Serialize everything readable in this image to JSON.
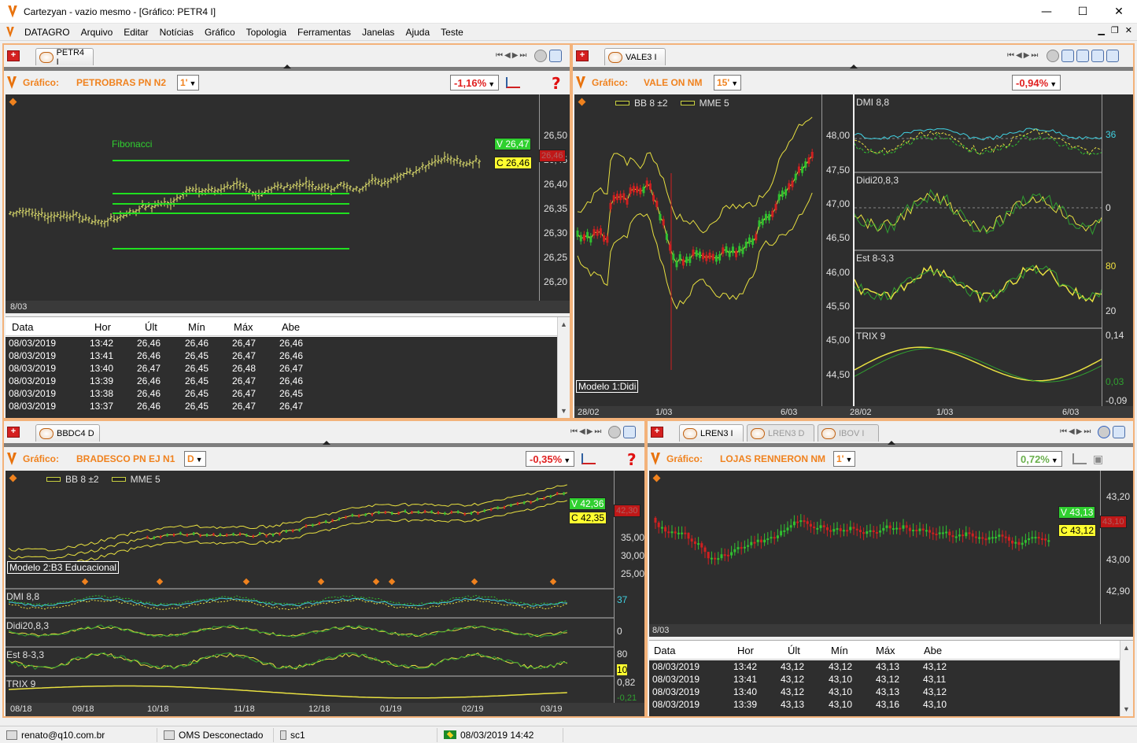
{
  "window": {
    "title": "Cartezyan - vazio mesmo - [Gráfico: PETR4 I]",
    "controls": [
      "—",
      "☐",
      "✕"
    ]
  },
  "menu": [
    "DATAGRO",
    "Arquivo",
    "Editar",
    "Notícias",
    "Gráfico",
    "Topologia",
    "Ferramentas",
    "Janelas",
    "Ajuda",
    "Teste"
  ],
  "panels": {
    "petr4": {
      "tab": "PETR4 I",
      "label": "Gráfico:",
      "name": "PETROBRAS PN N2",
      "period": "1'",
      "change": "-1,16%",
      "annotation": "Fibonacci",
      "y_ticks": [
        "26,50",
        "26,45",
        "26,40",
        "26,35",
        "26,30",
        "26,25",
        "26,20"
      ],
      "badge_v": "V 26,47",
      "badge_c": "C 26,46",
      "badge_last": "26,46",
      "x_label": "8/03",
      "table": {
        "headers": [
          "Data",
          "Hor",
          "Últ",
          "Mín",
          "Máx",
          "Abe"
        ],
        "rows": [
          [
            "08/03/2019",
            "13:42",
            "26,46",
            "26,46",
            "26,47",
            "26,46"
          ],
          [
            "08/03/2019",
            "13:41",
            "26,46",
            "26,45",
            "26,47",
            "26,46"
          ],
          [
            "08/03/2019",
            "13:40",
            "26,47",
            "26,45",
            "26,48",
            "26,47"
          ],
          [
            "08/03/2019",
            "13:39",
            "26,46",
            "26,45",
            "26,47",
            "26,46"
          ],
          [
            "08/03/2019",
            "13:38",
            "26,46",
            "26,45",
            "26,47",
            "26,45"
          ],
          [
            "08/03/2019",
            "13:37",
            "26,46",
            "26,45",
            "26,47",
            "26,47"
          ]
        ]
      }
    },
    "vale3": {
      "tab": "VALE3 I",
      "label": "Gráfico:",
      "name": "VALE ON NM",
      "period": "15'",
      "change": "-0,94%",
      "legend": [
        "BB 8 ±2",
        "MME 5"
      ],
      "model": "Modelo 1:Didi",
      "y_ticks": [
        "48,00",
        "47,50",
        "47,00",
        "46,50",
        "46,00",
        "45,50",
        "45,00",
        "44,50"
      ],
      "x_ticks": [
        "28/02",
        "1/03",
        "6/03"
      ],
      "indicators": [
        {
          "name": "DMI 8,8",
          "right": "36"
        },
        {
          "name": "Didi20,8,3",
          "right": "0"
        },
        {
          "name": "Est  8-3,3",
          "right": "80",
          "right2": "20"
        },
        {
          "name": "TRIX 9",
          "right": "0,14",
          "right2": "0,03",
          "right3": "-0,09"
        }
      ],
      "ind_x_ticks": [
        "28/02",
        "1/03",
        "6/03"
      ]
    },
    "bbdc4": {
      "tab": "BBDC4 D",
      "label": "Gráfico:",
      "name": "BRADESCO PN EJ N1",
      "period": "D",
      "change": "-0,35%",
      "legend": [
        "BB 8 ±2",
        "MME 5"
      ],
      "model": "Modelo 2:B3 Educacional",
      "y_ticks": [
        "35,00",
        "30,00",
        "25,00"
      ],
      "badge_v": "V 42,36",
      "badge_c": "C 42,35",
      "badge_last": "42,30",
      "indicators": [
        {
          "name": "DMI 8,8",
          "right": "37"
        },
        {
          "name": "Didi20,8,3",
          "right": "0"
        },
        {
          "name": "Est  8-3,3",
          "right": "80",
          "right2": "10"
        },
        {
          "name": "TRIX 9",
          "right": "0,82",
          "right2": "-0,21"
        }
      ],
      "x_ticks": [
        "08/18",
        "09/18",
        "10/18",
        "11/18",
        "12/18",
        "01/19",
        "02/19",
        "03/19"
      ]
    },
    "lren3": {
      "tabs": [
        "LREN3 I",
        "LREN3 D",
        "IBOV I"
      ],
      "label": "Gráfico:",
      "name": "LOJAS RENNERON NM",
      "period": "1'",
      "change": "0,72%",
      "y_ticks": [
        "43,20",
        "43,00",
        "42,90"
      ],
      "badge_v": "V 43,13",
      "badge_c": "C 43,12",
      "badge_last": "43,10",
      "x_label": "8/03",
      "table": {
        "headers": [
          "Data",
          "Hor",
          "Últ",
          "Mín",
          "Máx",
          "Abe"
        ],
        "rows": [
          [
            "08/03/2019",
            "13:42",
            "43,12",
            "43,12",
            "43,13",
            "43,12"
          ],
          [
            "08/03/2019",
            "13:41",
            "43,12",
            "43,10",
            "43,12",
            "43,11"
          ],
          [
            "08/03/2019",
            "13:40",
            "43,12",
            "43,10",
            "43,13",
            "43,12"
          ],
          [
            "08/03/2019",
            "13:39",
            "43,13",
            "43,10",
            "43,16",
            "43,10"
          ]
        ]
      }
    }
  },
  "status": {
    "user": "renato@q10.com.br",
    "oms": "OMS Desconectado",
    "sc": "sc1",
    "datetime": "08/03/2019 14:42"
  }
}
